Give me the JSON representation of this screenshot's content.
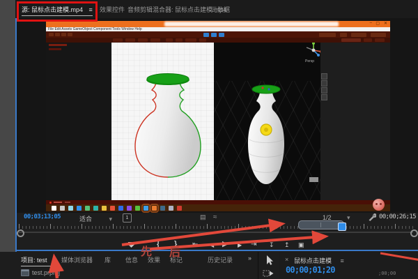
{
  "colors": {
    "accent_blue": "#2d8ceb",
    "annotation_red": "#e2483a",
    "focus_border": "#3a79c9",
    "titlebar_orange": "#ed6f1d"
  },
  "source_monitor": {
    "tabs": [
      {
        "label": "源: 鼠标点击建模.mp4",
        "menu": "≡"
      },
      {
        "label": "效果控件"
      },
      {
        "label": "音频剪辑混合器: 鼠标点击建模.mp4"
      },
      {
        "label": "元数据"
      }
    ],
    "current_time": "00;03;13;05",
    "fit_label": "适合",
    "dropdown_caret": "▾",
    "one_button_label": "1",
    "settings_page_icon": "▤",
    "audio_waveform_icon": "≈",
    "playback_resolution": "1/2",
    "duration": "00;00;26;15",
    "transport": {
      "mark_in": "{",
      "mark_out": "}",
      "goto_in": "⇤",
      "step_back": "◀",
      "play": "▶",
      "step_forward": "▶",
      "goto_out": "⇥",
      "insert": "↧",
      "overwrite": "↥",
      "export_frame": "▣"
    }
  },
  "video": {
    "menu_text": "File   Edit   Assets   GameObject   Component   Tools   Window   Help",
    "persp_label": "Persp",
    "min": "–",
    "max": "▢",
    "close": "✕",
    "taskbar_icon_colors": [
      "#ffffff",
      "#c9c9c9",
      "#8fd7e8",
      "#2f8fe8",
      "#57c27a",
      "#2fb3a8",
      "#e8c23f",
      "#e85038",
      "#2f6ae8",
      "#8a4ae8",
      "#57c23f",
      "#3fa0e8",
      "#e87a2f",
      "#3f6a8a",
      "#aeb2c4",
      "#d03a2f"
    ]
  },
  "project_panel": {
    "tabs": [
      "项目: test",
      "媒体浏览器",
      "库",
      "信息",
      "效果",
      "标记",
      "历史记录"
    ],
    "menu": "≡",
    "overflow": "»",
    "file_name": "test.prproj"
  },
  "timeline_panel": {
    "close": "×",
    "title": "鼠标点击建模",
    "menu": "≡",
    "current_time": "00;00;01;20",
    "ruler_label": ";00;00"
  },
  "annotations": {
    "label_first": "先",
    "label_second": "后"
  }
}
